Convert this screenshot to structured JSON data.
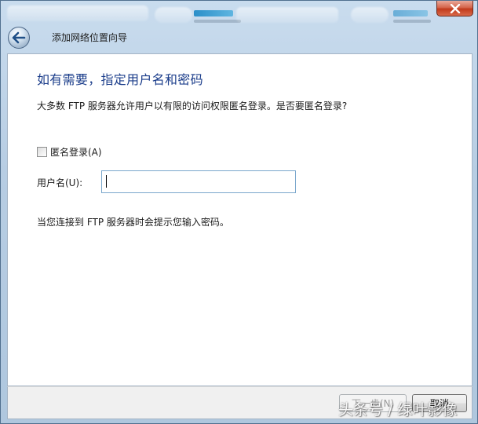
{
  "window": {
    "title": "添加网络位置向导",
    "close_glyph": "✕"
  },
  "page": {
    "heading": "如有需要，指定用户名和密码",
    "description": "大多数 FTP 服务器允许用户以有限的访问权限匿名登录。是否要匿名登录?",
    "anonymous_checkbox": {
      "label": "匿名登录(A)",
      "checked": false
    },
    "username": {
      "label": "用户名(U):",
      "value": "",
      "placeholder": ""
    },
    "note": "当您连接到 FTP 服务器时会提示您输入密码。"
  },
  "footer": {
    "next_label": "下一步(N)",
    "cancel_label": "取消"
  },
  "watermark": "头条号 / 绿叶影像",
  "icons": {
    "back": "back-arrow-icon",
    "close": "close-icon"
  },
  "colors": {
    "heading": "#1a3c8a",
    "close_button": "#c13a1c",
    "input_border": "#7aa7cc"
  }
}
